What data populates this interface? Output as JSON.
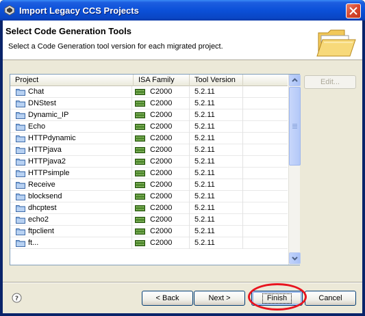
{
  "window": {
    "title": "Import Legacy CCS Projects"
  },
  "header": {
    "title": "Select Code Generation Tools",
    "subtitle": "Select a Code Generation tool version for each migrated project."
  },
  "table": {
    "columns": [
      "Project",
      "ISA Family",
      "Tool Version"
    ],
    "rows": [
      {
        "project": "Chat",
        "isa": "C2000",
        "tool": "5.2.11"
      },
      {
        "project": "DNStest",
        "isa": "C2000",
        "tool": "5.2.11"
      },
      {
        "project": "Dynamic_IP",
        "isa": "C2000",
        "tool": "5.2.11"
      },
      {
        "project": "Echo",
        "isa": "C2000",
        "tool": "5.2.11"
      },
      {
        "project": "HTTPdynamic",
        "isa": "C2000",
        "tool": "5.2.11"
      },
      {
        "project": "HTTPjava",
        "isa": "C2000",
        "tool": "5.2.11"
      },
      {
        "project": "HTTPjava2",
        "isa": "C2000",
        "tool": "5.2.11"
      },
      {
        "project": "HTTPsimple",
        "isa": "C2000",
        "tool": "5.2.11"
      },
      {
        "project": "Receive",
        "isa": "C2000",
        "tool": "5.2.11"
      },
      {
        "project": "blocksend",
        "isa": "C2000",
        "tool": "5.2.11"
      },
      {
        "project": "dhcptest",
        "isa": "C2000",
        "tool": "5.2.11"
      },
      {
        "project": "echo2",
        "isa": "C2000",
        "tool": "5.2.11"
      },
      {
        "project": "ftpclient",
        "isa": "C2000",
        "tool": "5.2.11"
      },
      {
        "project": "ft...",
        "isa": "C2000",
        "tool": "5.2.11"
      }
    ]
  },
  "buttons": {
    "edit": "Edit...",
    "back": "< Back",
    "next": "Next >",
    "finish": "Finish",
    "cancel": "Cancel"
  },
  "icons": {
    "window": "eclipse-icon",
    "header": "open-folder-icon",
    "project": "folder-icon",
    "isa": "chip-icon",
    "help": "help-icon"
  },
  "colors": {
    "titlebar": "#0b50d8",
    "close": "#d8482f",
    "highlight_ring": "#e8141f",
    "dialog": "#ece9d8"
  }
}
